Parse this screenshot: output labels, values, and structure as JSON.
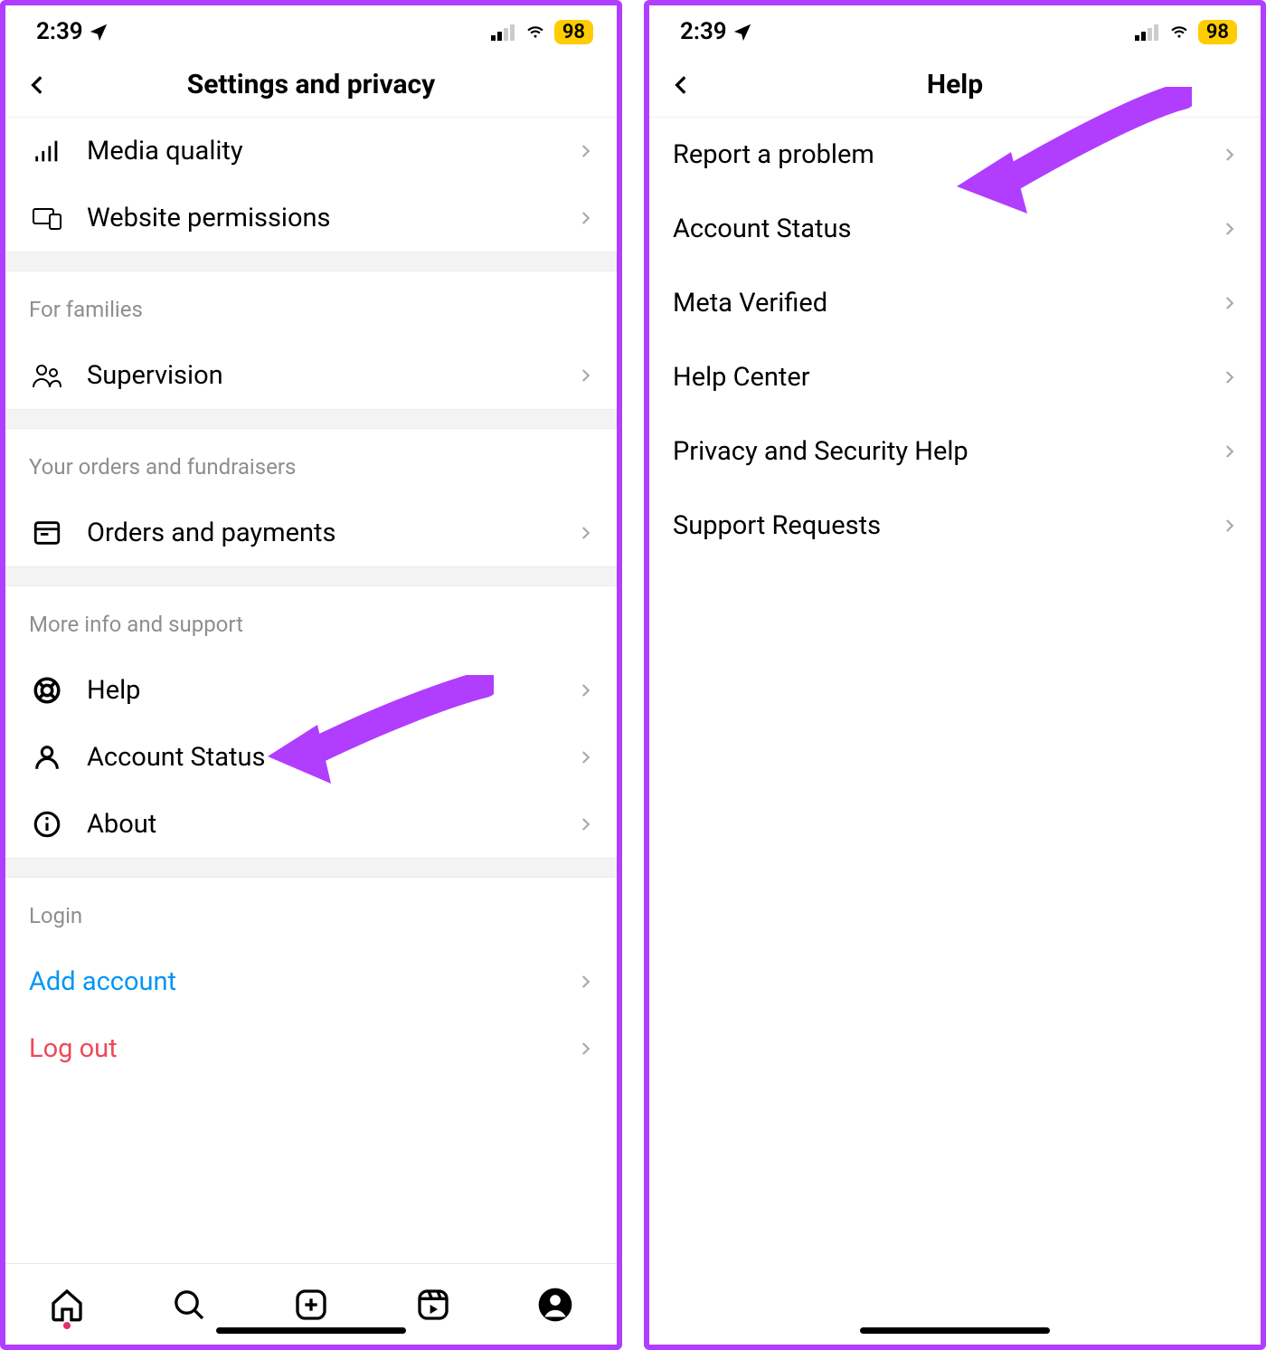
{
  "status": {
    "time": "2:39",
    "battery": "98"
  },
  "left": {
    "title": "Settings and privacy",
    "top_rows": [
      {
        "id": "media-quality",
        "label": "Media quality"
      },
      {
        "id": "website-permissions",
        "label": "Website permissions"
      }
    ],
    "families_header": "For families",
    "families_rows": [
      {
        "id": "supervision",
        "label": "Supervision"
      }
    ],
    "orders_header": "Your orders and fundraisers",
    "orders_rows": [
      {
        "id": "orders-payments",
        "label": "Orders and payments"
      }
    ],
    "support_header": "More info and support",
    "support_rows": [
      {
        "id": "help",
        "label": "Help"
      },
      {
        "id": "account-status",
        "label": "Account Status"
      },
      {
        "id": "about",
        "label": "About"
      }
    ],
    "login_header": "Login",
    "login_rows": [
      {
        "id": "add-account",
        "label": "Add account",
        "color": "blue"
      },
      {
        "id": "log-out",
        "label": "Log out",
        "color": "red"
      }
    ]
  },
  "right": {
    "title": "Help",
    "rows": [
      {
        "id": "report-problem",
        "label": "Report a problem"
      },
      {
        "id": "account-status",
        "label": "Account Status"
      },
      {
        "id": "meta-verified",
        "label": "Meta Verified"
      },
      {
        "id": "help-center",
        "label": "Help Center"
      },
      {
        "id": "privacy-security-help",
        "label": "Privacy and Security Help"
      },
      {
        "id": "support-requests",
        "label": "Support Requests"
      }
    ]
  }
}
